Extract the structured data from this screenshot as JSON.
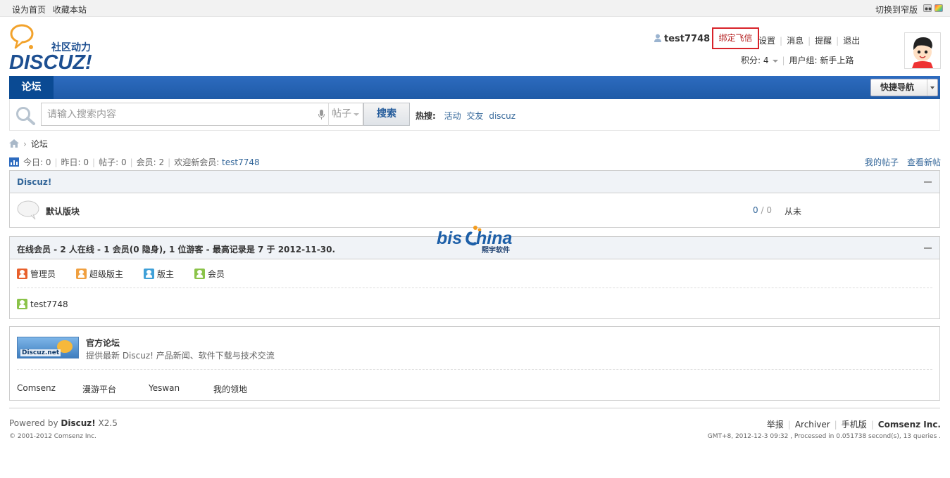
{
  "topbar": {
    "set_home": "设为首页",
    "bookmark": "收藏本站",
    "switch_width": "切换到窄版"
  },
  "logo": {
    "slogan": "社区动力",
    "brand": "DISCUZ!"
  },
  "user": {
    "name": "test7748",
    "bind_feixin": "绑定飞信",
    "settings": "设置",
    "messages": "消息",
    "reminders": "提醒",
    "logout": "退出",
    "points_label": "积分: 4",
    "usergroup": "用户组: 新手上路"
  },
  "nav": {
    "forum_tab": "论坛",
    "quick_nav": "快捷导航"
  },
  "search": {
    "placeholder": "请输入搜索内容",
    "type": "帖子",
    "button": "搜索",
    "hot_label": "热搜:",
    "hot_terms": [
      "活动",
      "交友",
      "discuz"
    ]
  },
  "breadcrumb": {
    "current": "论坛"
  },
  "stats": {
    "today": "今日: 0",
    "yesterday": "昨日: 0",
    "posts": "帖子: 0",
    "members": "会员: 2",
    "welcome_label": "欢迎新会员: ",
    "newest_member": "test7748",
    "my_posts": "我的帖子",
    "new_posts": "查看新帖"
  },
  "category": {
    "title": "Discuz!",
    "forum_name": "默认版块",
    "threads": "0",
    "posts": "0",
    "last_post": "从未"
  },
  "online": {
    "title": "在线会员 - 2 人在线 - 1 会员(0 隐身), 1 位游客 - 最高记录是 7 于 2012-11-30.",
    "legend": [
      "管理员",
      "超级版主",
      "版主",
      "会员"
    ],
    "legend_colors": [
      "#e8602c",
      "#f0a040",
      "#3fa0d8",
      "#8bc34a"
    ],
    "member": "test7748"
  },
  "watermark": {
    "brand_left": "bis",
    "brand_right": "hina",
    "subtitle": "熙宇软件"
  },
  "links": {
    "official_logo_text": "Discuz.net",
    "official_title": "官方论坛",
    "official_desc": "提供最新 Discuz! 产品新闻、软件下载与技术交流",
    "friends": [
      "Comsenz",
      "漫游平台",
      "Yeswan",
      "我的领地"
    ]
  },
  "footer": {
    "powered_prefix": "Powered by ",
    "powered_brand": "Discuz!",
    "powered_version": " X2.5",
    "copyright": "© 2001-2012 Comsenz Inc.",
    "report": "举报",
    "archiver": "Archiver",
    "mobile": "手机版",
    "company": "Comsenz Inc.",
    "server_info": "GMT+8, 2012-12-3 09:32 , Processed in 0.051738 second(s), 13 queries ."
  },
  "colors": {
    "nav_blue": "#1f5ba7",
    "nav_active": "#0a4a93",
    "link_blue": "#336699",
    "highlight_red": "#d8232a"
  }
}
